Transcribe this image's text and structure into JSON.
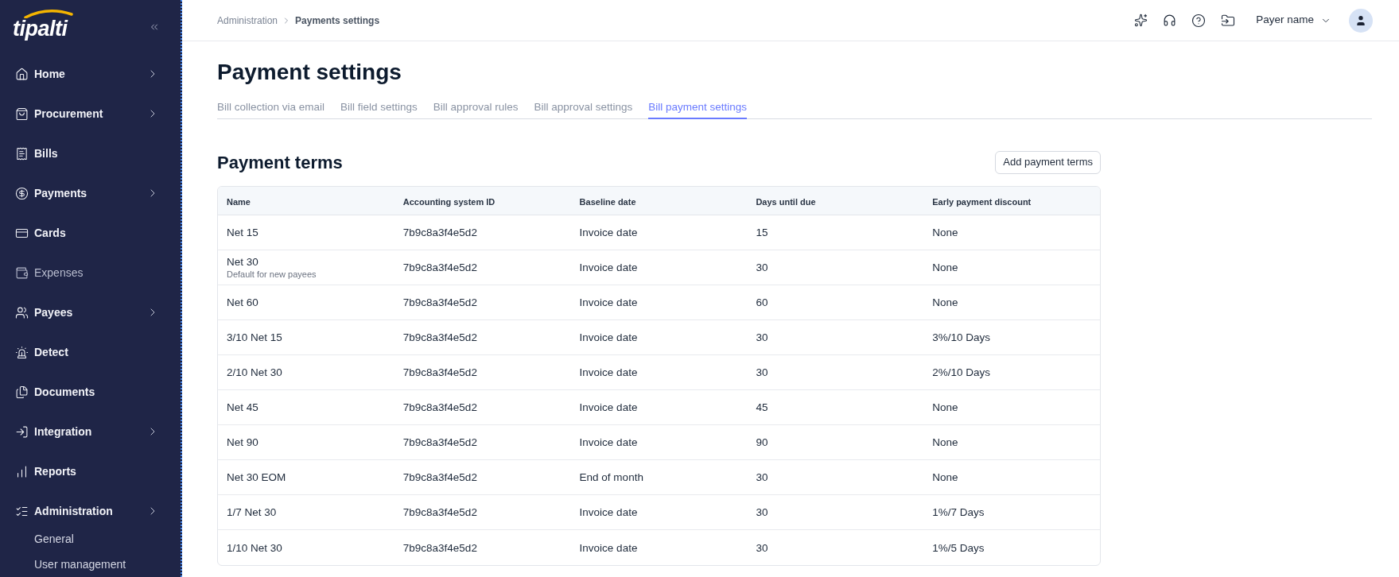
{
  "sidebar": {
    "logo": "tipalti",
    "items": [
      {
        "label": "Home",
        "submenu": true,
        "disabled": false
      },
      {
        "label": "Procurement",
        "submenu": true,
        "disabled": false
      },
      {
        "label": "Bills",
        "submenu": false,
        "disabled": false
      },
      {
        "label": "Payments",
        "submenu": true,
        "disabled": false
      },
      {
        "label": "Cards",
        "submenu": false,
        "disabled": false
      },
      {
        "label": "Expenses",
        "submenu": false,
        "disabled": true
      },
      {
        "label": "Payees",
        "submenu": true,
        "disabled": false
      },
      {
        "label": "Detect",
        "submenu": false,
        "disabled": false
      },
      {
        "label": "Documents",
        "submenu": false,
        "disabled": false
      },
      {
        "label": "Integration",
        "submenu": true,
        "disabled": false
      },
      {
        "label": "Reports",
        "submenu": false,
        "disabled": false
      },
      {
        "label": "Administration",
        "submenu": true,
        "disabled": false,
        "children": [
          {
            "label": "General"
          },
          {
            "label": "User management"
          }
        ]
      }
    ]
  },
  "top_bar": {
    "breadcrumb": [
      {
        "label": "Administration",
        "current": false
      },
      {
        "label": "Payments settings",
        "current": true
      }
    ],
    "account": "Payer name"
  },
  "page": {
    "title": "Payment settings",
    "tabs": [
      {
        "label": "Bill collection via email",
        "selected": false
      },
      {
        "label": "Bill field settings",
        "selected": false
      },
      {
        "label": "Bill approval rules",
        "selected": false
      },
      {
        "label": "Bill approval settings",
        "selected": false
      },
      {
        "label": "Bill payment settings",
        "selected": true
      }
    ]
  },
  "payment_terms": {
    "title": "Payment terms",
    "add_button": "Add payment terms",
    "table": {
      "columns": [
        "Name",
        "Accounting system ID",
        "Baseline date",
        "Days until due",
        "Early payment discount"
      ],
      "rows": [
        {
          "cells": [
            "Net 15",
            "7b9c8a3f4e5d2",
            "Invoice date",
            "15",
            "None"
          ]
        },
        {
          "cells": [
            "Net 30",
            "7b9c8a3f4e5d2",
            "Invoice date",
            "30",
            "None"
          ],
          "note": "Default for new payees"
        },
        {
          "cells": [
            "Net 60",
            "7b9c8a3f4e5d2",
            "Invoice date",
            "60",
            "None"
          ]
        },
        {
          "cells": [
            "3/10 Net 15",
            "7b9c8a3f4e5d2",
            "Invoice date",
            "30",
            "3%/10 Days"
          ]
        },
        {
          "cells": [
            "2/10 Net 30",
            "7b9c8a3f4e5d2",
            "Invoice date",
            "30",
            "2%/10 Days"
          ]
        },
        {
          "cells": [
            "Net 45",
            "7b9c8a3f4e5d2",
            "Invoice date",
            "45",
            "None"
          ]
        },
        {
          "cells": [
            "Net 90",
            "7b9c8a3f4e5d2",
            "Invoice date",
            "90",
            "None"
          ]
        },
        {
          "cells": [
            "Net 30 EOM",
            "7b9c8a3f4e5d2",
            "End of month",
            "30",
            "None"
          ]
        },
        {
          "cells": [
            "1/7 Net 30",
            "7b9c8a3f4e5d2",
            "Invoice date",
            "30",
            "1%/7 Days"
          ]
        },
        {
          "cells": [
            "1/10 Net 30",
            "7b9c8a3f4e5d2",
            "Invoice date",
            "30",
            "1%/5 Days"
          ]
        }
      ]
    }
  }
}
